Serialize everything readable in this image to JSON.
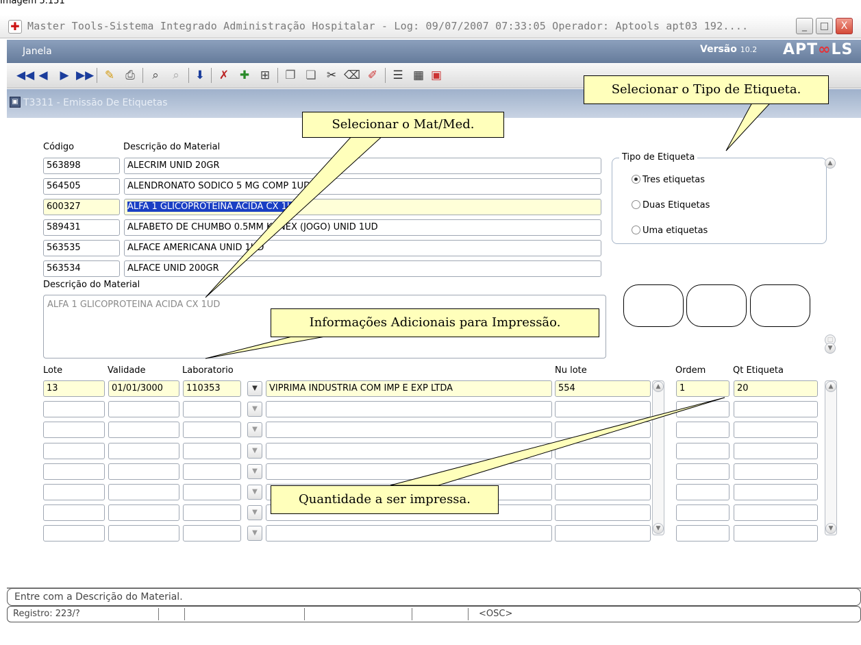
{
  "caption": "Imagem 5.151",
  "window": {
    "title": "Master Tools-Sistema Integrado Administração Hospitalar - Log: 09/07/2007 07:33:05 Operador: Aptools apt03 192....",
    "minimize": "_",
    "maximize": "□",
    "close": "X"
  },
  "menubar": {
    "menu_janela": "Janela",
    "versao_label": "Versão",
    "versao_number": "10.2",
    "logo": "APTOOLS"
  },
  "toolbar": {
    "icons": [
      "first-record-icon",
      "prev-record-icon",
      "next-record-icon",
      "last-record-icon",
      "edit-icon",
      "print-icon",
      "query-icon",
      "query-execute-icon",
      "save-icon",
      "delete-record-icon",
      "insert-record-icon",
      "duplicate-icon",
      "copy-icon",
      "paste-icon",
      "cut-icon",
      "clear-icon",
      "pen-icon",
      "list-icon",
      "calendar-icon",
      "window-icon",
      "grid-icon",
      "help-icon",
      "key-icon",
      "exit-icon"
    ]
  },
  "form": {
    "title": "T3311 - Emissão De Etiquetas"
  },
  "materials": {
    "col_codigo": "Código",
    "col_descricao": "Descrição do Material",
    "rows": [
      {
        "codigo": "563898",
        "descricao": "ALECRIM UNID 20GR"
      },
      {
        "codigo": "564505",
        "descricao": "ALENDRONATO SODICO 5 MG COMP 1UD"
      },
      {
        "codigo": "600327",
        "descricao": "ALFA 1 GLICOPROTEINA ACIDA CX 1UD"
      },
      {
        "codigo": "589431",
        "descricao": "ALFABETO DE CHUMBO 0.5MM KONEX (JOGO) UNID 1UD"
      },
      {
        "codigo": "563535",
        "descricao": "ALFACE AMERICANA UNID 1UD"
      },
      {
        "codigo": "563534",
        "descricao": "ALFACE UNID 200GR"
      }
    ],
    "selected_index": 2
  },
  "tipo_etiqueta": {
    "label": "Tipo de Etiqueta",
    "options": [
      "Tres etiquetas",
      "Duas Etiquetas",
      "Uma etiquetas"
    ],
    "selected": "Tres etiquetas"
  },
  "descricao_material": {
    "label": "Descrição do Material",
    "value": "ALFA 1 GLICOPROTEINA ACIDA CX 1UD"
  },
  "lotes": {
    "col_lote": "Lote",
    "col_validade": "Validade",
    "col_laboratorio": "Laboratorio",
    "col_nu_lote": "Nu lote",
    "col_ordem": "Ordem",
    "col_qt_etiqueta": "Qt Etiqueta",
    "rows": [
      {
        "lote": "13",
        "validade": "01/01/3000",
        "lab_codigo": "110353",
        "lab_nome": "VIPRIMA INDUSTRIA COM IMP E EXP LTDA",
        "nu_lote": "554",
        "ordem": "1",
        "qt_etiqueta": "20"
      },
      {
        "lote": "",
        "validade": "",
        "lab_codigo": "",
        "lab_nome": "",
        "nu_lote": "",
        "ordem": "",
        "qt_etiqueta": ""
      },
      {
        "lote": "",
        "validade": "",
        "lab_codigo": "",
        "lab_nome": "",
        "nu_lote": "",
        "ordem": "",
        "qt_etiqueta": ""
      },
      {
        "lote": "",
        "validade": "",
        "lab_codigo": "",
        "lab_nome": "",
        "nu_lote": "",
        "ordem": "",
        "qt_etiqueta": ""
      },
      {
        "lote": "",
        "validade": "",
        "lab_codigo": "",
        "lab_nome": "",
        "nu_lote": "",
        "ordem": "",
        "qt_etiqueta": ""
      },
      {
        "lote": "",
        "validade": "",
        "lab_codigo": "",
        "lab_nome": "",
        "nu_lote": "",
        "ordem": "",
        "qt_etiqueta": ""
      },
      {
        "lote": "",
        "validade": "",
        "lab_codigo": "",
        "lab_nome": "",
        "nu_lote": "",
        "ordem": "",
        "qt_etiqueta": ""
      },
      {
        "lote": "",
        "validade": "",
        "lab_codigo": "",
        "lab_nome": "",
        "nu_lote": "",
        "ordem": "",
        "qt_etiqueta": ""
      }
    ]
  },
  "callouts": {
    "tipo": "Selecionar o Tipo de Etiqueta.",
    "matmed": "Selecionar o Mat/Med.",
    "info": "Informações Adicionais para Impressão.",
    "quantidade": "Quantidade a ser impressa."
  },
  "status": {
    "message": "Entre com a Descrição do Material.",
    "registro": "Registro: 223/?",
    "osc": "<OSC>"
  }
}
